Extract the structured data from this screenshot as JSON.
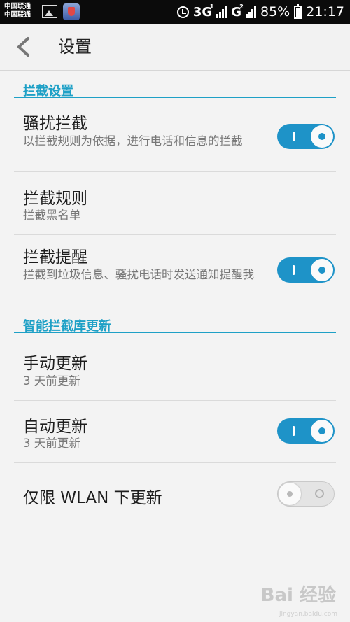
{
  "status_bar": {
    "carrier_1": "中国联通",
    "carrier_2": "中国联通",
    "network_1": "3G",
    "network_1_sub": "1",
    "network_2": "G",
    "network_2_sub": "2",
    "battery": "85%",
    "time": "21:17"
  },
  "header": {
    "title": "设置"
  },
  "sections": [
    {
      "title": "拦截设置"
    },
    {
      "title": "智能拦截库更新"
    }
  ],
  "items": [
    {
      "title": "骚扰拦截",
      "subtitle": "以拦截规则为依据，进行电话和信息的拦截",
      "toggle": "on"
    },
    {
      "title": "拦截规则",
      "subtitle": "拦截黑名单"
    },
    {
      "title": "拦截提醒",
      "subtitle": "拦截到垃圾信息、骚扰电话时发送通知提醒我",
      "toggle": "on"
    },
    {
      "title": "手动更新",
      "subtitle": "3 天前更新"
    },
    {
      "title": "自动更新",
      "subtitle": "3 天前更新",
      "toggle": "on"
    },
    {
      "title": "仅限 WLAN 下更新",
      "toggle": "off"
    }
  ],
  "watermark": {
    "text": "Bai 经验",
    "sub": "jingyan.baidu.com"
  },
  "colors": {
    "accent": "#1ea0c6",
    "toggle_on": "#1e93c8"
  }
}
